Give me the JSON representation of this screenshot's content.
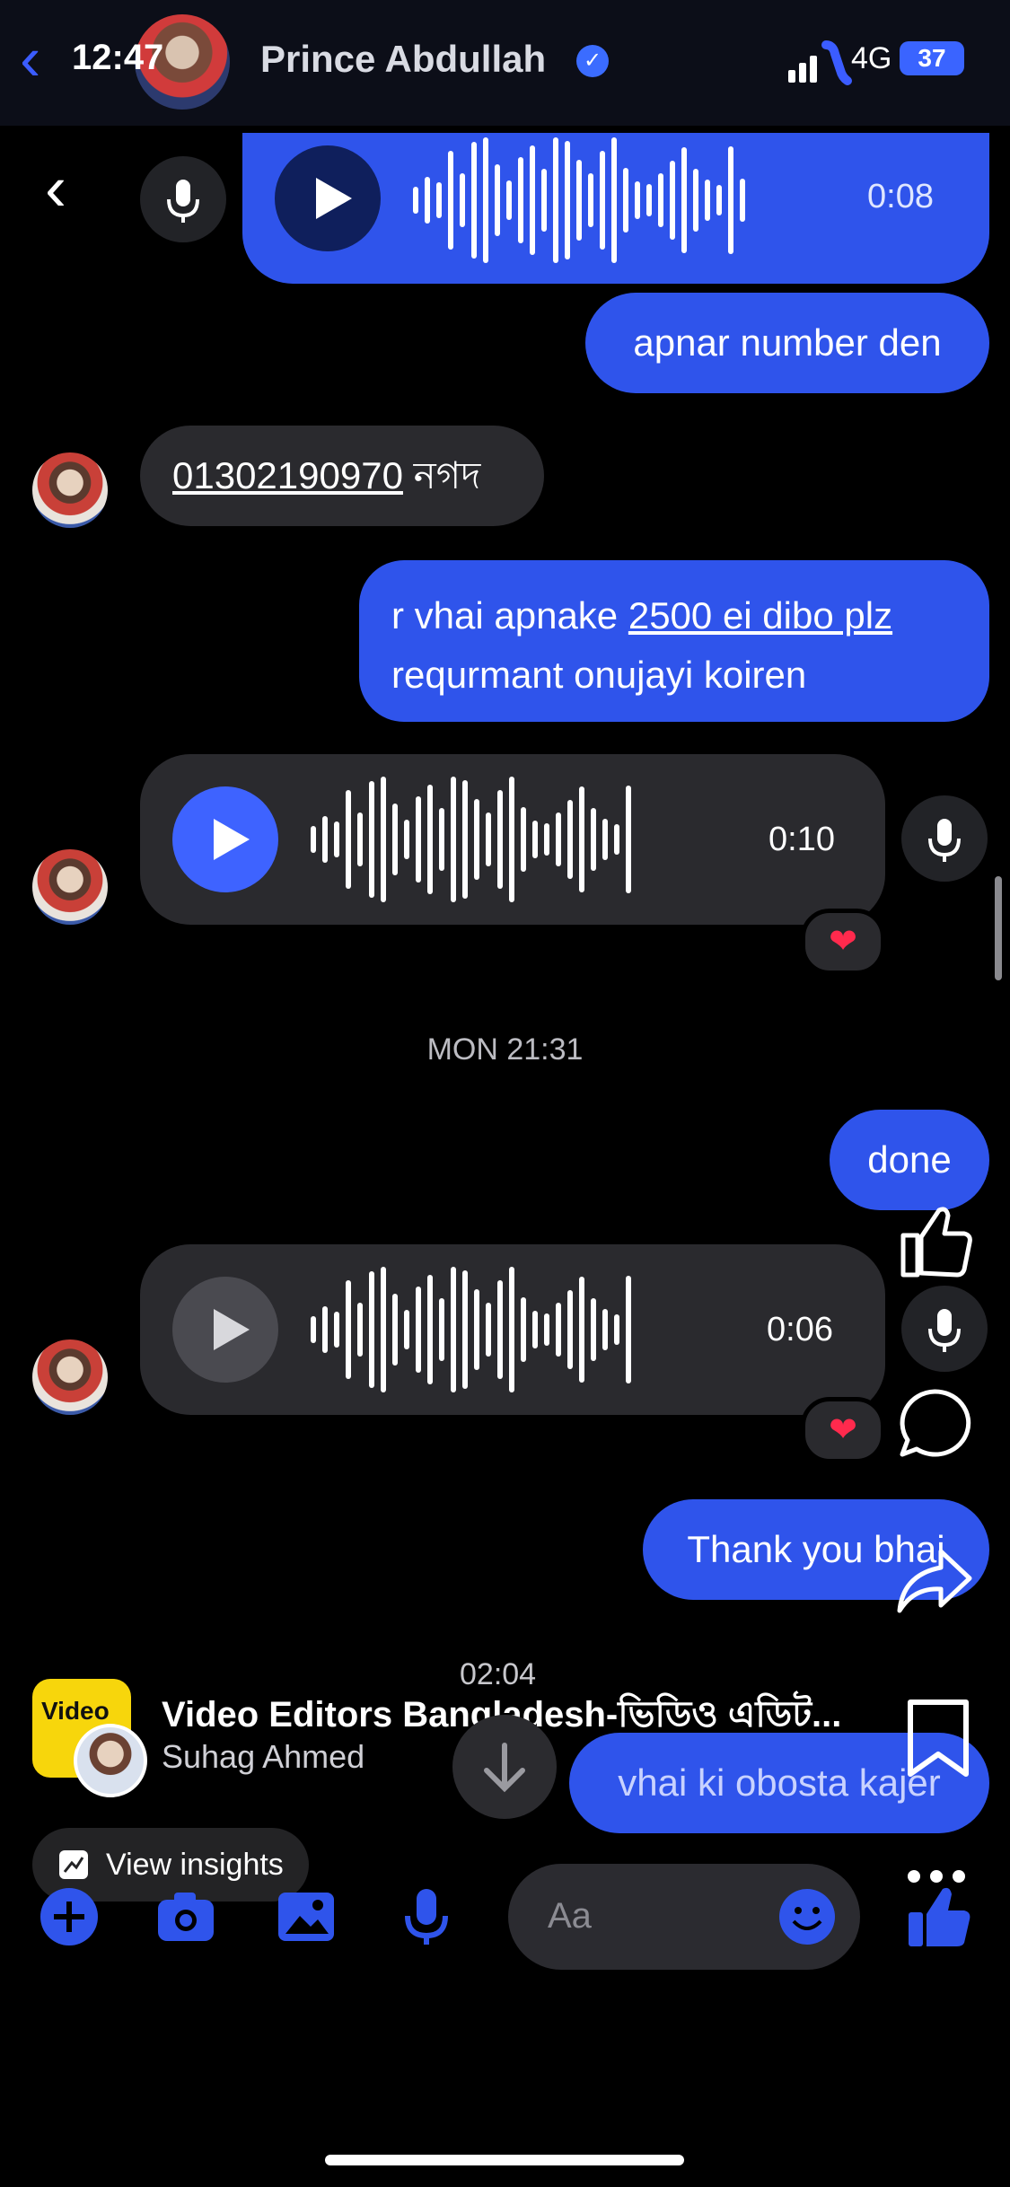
{
  "status_bar": {
    "time": "12:47",
    "network": "4G",
    "battery": "37"
  },
  "conversation": {
    "contact_name": "Prince Abdullah"
  },
  "messages": {
    "voice1_duration": "0:08",
    "out1": "apnar number den",
    "in1_number": "01302190970",
    "in1_suffix": "নগদ",
    "out2_line1_plain": "r vhai apnake ",
    "out2_line1_link": "2500 ei dibo plz",
    "out2_line2": "requrmant onujayi koiren",
    "voice2_duration": "0:10",
    "date_separator": "MON 21:31",
    "out3": "done",
    "voice3_duration": "0:06",
    "out4": "Thank you bhai",
    "out5": "vhai ki obosta kajer"
  },
  "post": {
    "page_name": "Video Editors Bangladesh-ভিডিও এডিট...",
    "author": "Suhag Ahmed",
    "time": "02:04",
    "insights_label": "View insights",
    "logo_text": "Video"
  },
  "composer": {
    "placeholder": "Aa"
  },
  "colors": {
    "accent": "#2f54eb",
    "heart": "#ff2a4d"
  }
}
